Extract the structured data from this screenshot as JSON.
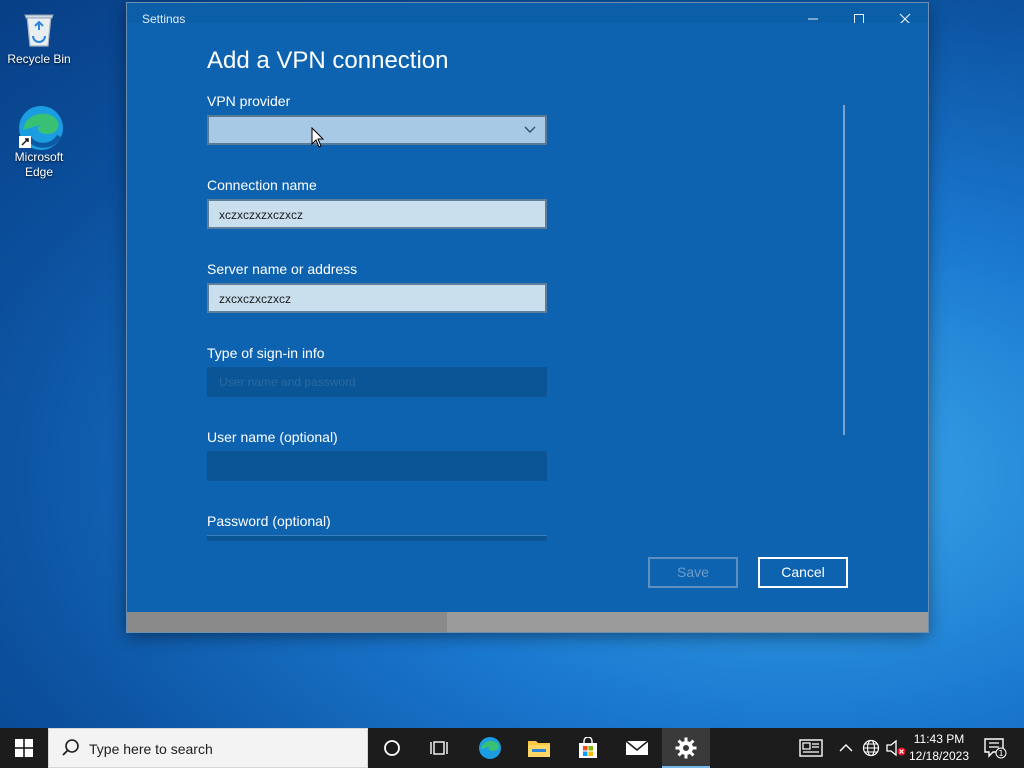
{
  "desktop": {
    "icons": [
      {
        "label": "Recycle Bin",
        "icon": "recycle-bin-icon"
      },
      {
        "label": "Microsoft Edge",
        "icon": "edge-icon"
      }
    ]
  },
  "window": {
    "title": "Settings",
    "heading": "Add a VPN connection",
    "fields": {
      "provider": {
        "label": "VPN provider",
        "value": ""
      },
      "connection_name": {
        "label": "Connection name",
        "value": "xczxczxzxczxcz"
      },
      "server": {
        "label": "Server name or address",
        "value": "zxcxczxczxcz"
      },
      "signin_type": {
        "label": "Type of sign-in info",
        "value": "User name and password"
      },
      "username": {
        "label": "User name (optional)",
        "value": ""
      },
      "password": {
        "label": "Password (optional)",
        "value": ""
      }
    },
    "buttons": {
      "save": "Save",
      "cancel": "Cancel"
    }
  },
  "taskbar": {
    "search_placeholder": "Type here to search",
    "time": "11:43 PM",
    "date": "12/18/2023",
    "notification_count": "1"
  },
  "colors": {
    "window_bg": "#0d63af",
    "accent": "#76b9ed",
    "taskbar": "#1c1c1c"
  }
}
